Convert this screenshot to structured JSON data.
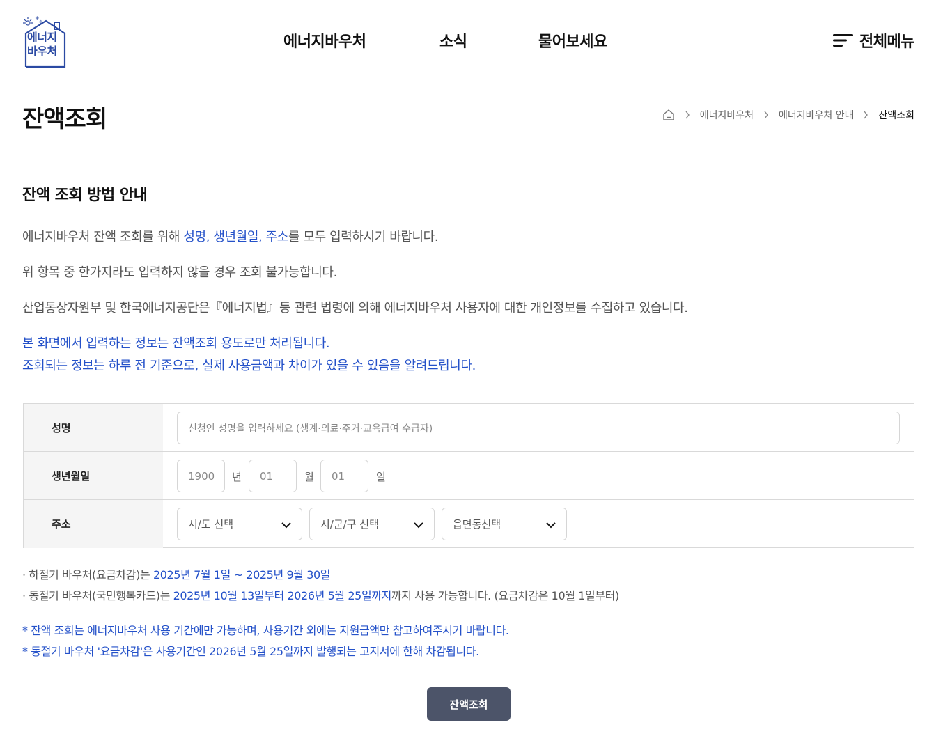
{
  "header": {
    "logo_text_line1": "에너지",
    "logo_text_line2": "바우처",
    "nav": [
      "에너지바우처",
      "소식",
      "물어보세요"
    ],
    "menu_label": "전체메뉴"
  },
  "page": {
    "title": "잔액조회",
    "breadcrumb": [
      "에너지바우처",
      "에너지바우처 안내",
      "잔액조회"
    ]
  },
  "guide": {
    "title": "잔액 조회 방법 안내",
    "line1_prefix": "에너지바우처 잔액 조회를 위해 ",
    "line1_highlight": "성명, 생년월일, 주소",
    "line1_suffix": "를 모두 입력하시기 바랍니다.",
    "line2": "위 항목 중 한가지라도 입력하지 않을 경우 조회 불가능합니다.",
    "line3": "산업통상자원부 및 한국에너지공단은『에너지법』등 관련 법령에 의해 에너지바우처 사용자에 대한 개인정보를 수집하고 있습니다.",
    "line4": "본 화면에서 입력하는 정보는 잔액조회 용도로만 처리됩니다.",
    "line5": "조회되는 정보는 하루 전 기준으로, 실제 사용금액과 차이가 있을 수 있음을 알려드립니다."
  },
  "form": {
    "name_label": "성명",
    "name_placeholder": "신청인 성명을 입력하세요 (생계·의료·주거·교육급여 수급자)",
    "birth_label": "생년월일",
    "birth_year": "1900",
    "birth_year_unit": "년",
    "birth_month": "01",
    "birth_month_unit": "월",
    "birth_day": "01",
    "birth_day_unit": "일",
    "address_label": "주소",
    "sido_select": "시/도 선택",
    "sigungu_select": "시/군/구 선택",
    "eupmyeondong_select": "읍면동선택"
  },
  "notes": {
    "summer_prefix": "· 하절기 바우처(요금차감)는 ",
    "summer_period": "2025년 7월 1일 ~ 2025년 9월 30일",
    "winter_prefix": "· 동절기 바우처(국민행복카드)는 ",
    "winter_period": "2025년 10월 13일부터 2026년 5월 25일까지",
    "winter_suffix": "까지 사용 가능합니다. (요금차감은 10월 1일부터)",
    "star1": "* 잔액 조회는 에너지바우처 사용 기간에만 가능하며, 사용기간 외에는 지원금액만 참고하여주시기 바랍니다.",
    "star2": "* 동절기 바우처 '요금차감'은 사용기간인 2026년 5월 25일까지 발행되는 고지서에 한해 차감됩니다."
  },
  "submit_label": "잔액조회",
  "colors": {
    "brand_blue": "#2b4aa3",
    "highlight_blue": "#2451c9",
    "button_bg": "#4c5469"
  }
}
